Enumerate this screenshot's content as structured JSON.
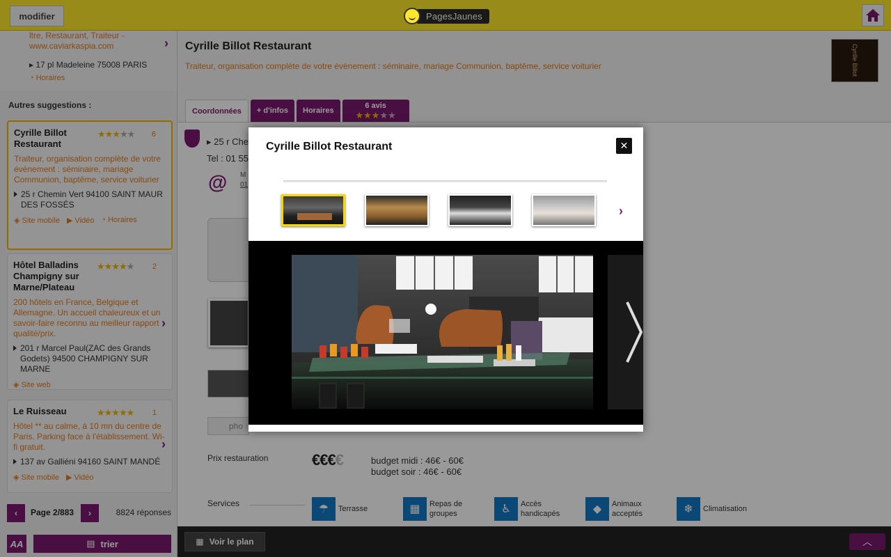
{
  "topbar": {
    "modifier_label": "modifier",
    "logo_text": "PagesJaunes"
  },
  "sidebar": {
    "prev_line1": "ltre, Restaurant, Traiteur -",
    "prev_line2": "www.caviarkaspia.com",
    "prev_address": "17 pl Madeleine 75008 PARIS",
    "prev_hours": "Horaires",
    "suggest_title": "Autres suggestions :",
    "cards": [
      {
        "name": "Cyrille Billot Restaurant",
        "rating": 3,
        "count": "6",
        "desc": "Traiteur, organisation complète de votre évènement : séminaire, mariage Communion, baptême, service voiturier",
        "address": "25 r Chemin Vert 94100 SAINT MAUR DES FOSSÉS",
        "links": [
          "Site mobile",
          "Vidéo",
          "Horaires"
        ]
      },
      {
        "name": "Hôtel Balladins Champigny sur Marne/Plateau",
        "rating": 4,
        "count": "2",
        "desc": "200 hôtels en France, Belgique et Allemagne. Un accueil chaleureux et un savoir-faire reconnu au meilleur rapport qualité/prix.",
        "address": "201 r Marcel Paul(ZAC des Grands Godets) 94500 CHAMPIGNY SUR MARNE",
        "links": [
          "Site web"
        ]
      },
      {
        "name": "Le Ruisseau",
        "rating": 5,
        "count": "1",
        "desc": "Hôtel ** au calme, à 10 mn du centre de Paris. Parking face à l'établissement. Wi-fi gratuit.",
        "address": "137 av Galliéni 94160 SAINT MANDÉ",
        "links": [
          "Site mobile",
          "Vidéo"
        ]
      }
    ],
    "pager": {
      "page": "Page 2/883",
      "count": "8824 réponses"
    },
    "aa_label": "AA",
    "sort_label": "trier"
  },
  "main": {
    "name": "Cyrille Billot Restaurant",
    "tagline": "Traiteur, organisation complète de votre évènement : séminaire, mariage Communion, baptême, service voiturier",
    "logo_text": "Cyrille Billot",
    "tabs": [
      {
        "label": "Coordonnées"
      },
      {
        "label": "+ d'infos"
      },
      {
        "label": "Horaires"
      },
      {
        "label": "6 avis"
      }
    ],
    "avis_rating": 3,
    "address": "25 r Che",
    "tel": "Tel : 01 55",
    "mail_label": "M",
    "mail_link": "01",
    "photo_label": "pho",
    "prix_label": "Prix restauration",
    "euro_level": 3,
    "budget_midi": "budget midi : 46€ - 60€",
    "budget_soir": "budget soir : 46€ - 60€",
    "services_label": "Services",
    "services": [
      {
        "icon": "terrace-icon",
        "label": "Terrasse"
      },
      {
        "icon": "meals-icon",
        "label": "Repas de groupes"
      },
      {
        "icon": "wheelchair-icon",
        "label": "Accès handicapés"
      },
      {
        "icon": "pet-icon",
        "label": "Animaux acceptés"
      },
      {
        "icon": "snowflake-icon",
        "label": "Climatisation"
      }
    ]
  },
  "bottombar": {
    "plan_label": "Voir le plan"
  },
  "modal": {
    "title": "Cyrille Billot Restaurant",
    "close_label": "✕",
    "thumbnails_count": 4,
    "selected_index": 0
  },
  "colors": {
    "yellow": "#ffe82b",
    "purple": "#7a1a6e",
    "orange": "#e27a1b",
    "blue": "#1479c4"
  }
}
